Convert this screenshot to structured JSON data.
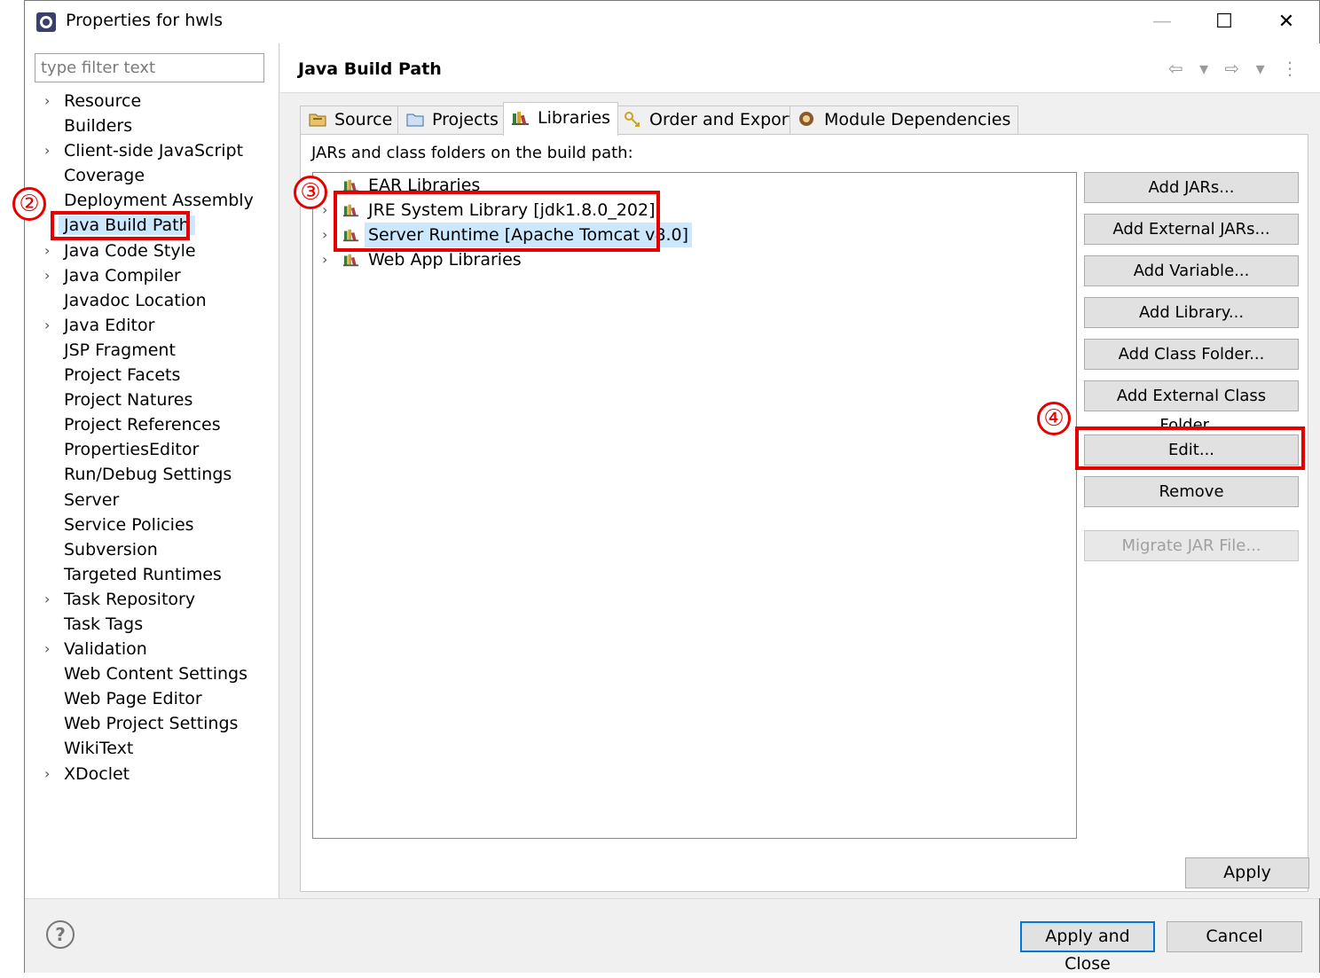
{
  "window": {
    "title": "Properties for hwls"
  },
  "titlebar": {
    "min": "—",
    "max": "☐",
    "close": "✕"
  },
  "filter": {
    "placeholder": "type filter text"
  },
  "nav": {
    "items": [
      {
        "label": "Resource",
        "expandable": true
      },
      {
        "label": "Builders",
        "expandable": false
      },
      {
        "label": "Client-side JavaScript",
        "expandable": true
      },
      {
        "label": "Coverage",
        "expandable": false
      },
      {
        "label": "Deployment Assembly",
        "expandable": false
      },
      {
        "label": "Java Build Path",
        "expandable": false,
        "selected": true
      },
      {
        "label": "Java Code Style",
        "expandable": true
      },
      {
        "label": "Java Compiler",
        "expandable": true
      },
      {
        "label": "Javadoc Location",
        "expandable": false
      },
      {
        "label": "Java Editor",
        "expandable": true
      },
      {
        "label": "JSP Fragment",
        "expandable": false
      },
      {
        "label": "Project Facets",
        "expandable": false
      },
      {
        "label": "Project Natures",
        "expandable": false
      },
      {
        "label": "Project References",
        "expandable": false
      },
      {
        "label": "PropertiesEditor",
        "expandable": false
      },
      {
        "label": "Run/Debug Settings",
        "expandable": false
      },
      {
        "label": "Server",
        "expandable": false
      },
      {
        "label": "Service Policies",
        "expandable": false
      },
      {
        "label": "Subversion",
        "expandable": false
      },
      {
        "label": "Targeted Runtimes",
        "expandable": false
      },
      {
        "label": "Task Repository",
        "expandable": true
      },
      {
        "label": "Task Tags",
        "expandable": false
      },
      {
        "label": "Validation",
        "expandable": true
      },
      {
        "label": "Web Content Settings",
        "expandable": false
      },
      {
        "label": "Web Page Editor",
        "expandable": false
      },
      {
        "label": "Web Project Settings",
        "expandable": false
      },
      {
        "label": "WikiText",
        "expandable": false
      },
      {
        "label": "XDoclet",
        "expandable": true
      }
    ]
  },
  "page": {
    "title": "Java Build Path",
    "nav_icons": "⇦ ▾ ⇨ ▾ ⋮"
  },
  "tabs": [
    {
      "label": "Source",
      "icon": "source-folder-icon"
    },
    {
      "label": "Projects",
      "icon": "projects-icon"
    },
    {
      "label": "Libraries",
      "icon": "libraries-icon",
      "active": true
    },
    {
      "label": "Order and Export",
      "icon": "order-export-icon"
    },
    {
      "label": "Module Dependencies",
      "icon": "module-dependencies-icon"
    }
  ],
  "libraries": {
    "caption": "JARs and class folders on the build path:",
    "tree": [
      {
        "label": "EAR Libraries",
        "expandable": false
      },
      {
        "label": "JRE System Library [jdk1.8.0_202]",
        "expandable": true
      },
      {
        "label": "Server Runtime [Apache Tomcat v8.0]",
        "expandable": true,
        "selected": true
      },
      {
        "label": "Web App Libraries",
        "expandable": true
      }
    ],
    "buttons": {
      "add_jars": "Add JARs...",
      "add_external_jars": "Add External JARs...",
      "add_variable": "Add Variable...",
      "add_library": "Add Library...",
      "add_class_folder": "Add Class Folder...",
      "add_external_class_folder": "Add External Class Folder...",
      "edit": "Edit...",
      "remove": "Remove",
      "migrate_jar": "Migrate JAR File..."
    }
  },
  "apply": "Apply",
  "footer": {
    "help": "?",
    "apply_close": "Apply and Close",
    "cancel": "Cancel"
  },
  "annotations": {
    "n2": "②",
    "n3": "③",
    "n4": "④",
    "color": "#e60000"
  }
}
